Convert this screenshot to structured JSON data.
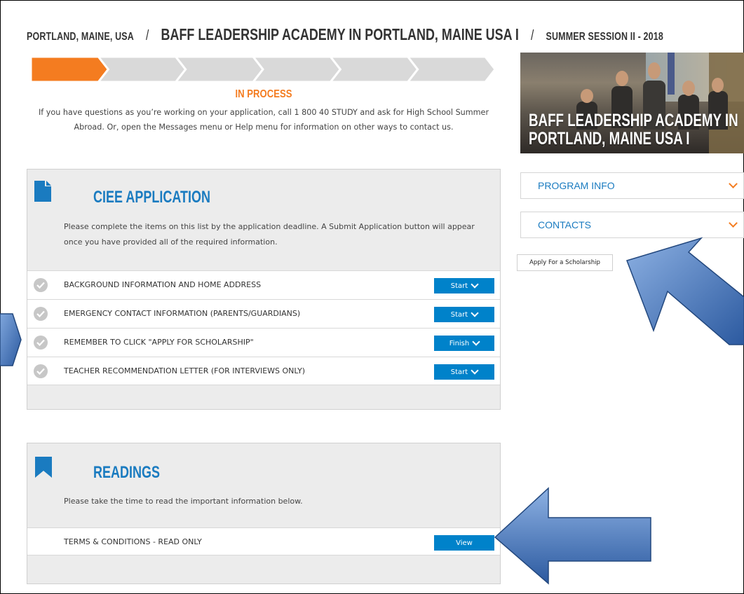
{
  "breadcrumb": {
    "location": "PORTLAND, MAINE, USA",
    "program": "BAFF LEADERSHIP ACADEMY IN PORTLAND, MAINE USA I",
    "session": "SUMMER SESSION II - 2018",
    "separator": "/"
  },
  "progress": {
    "steps_total": 6,
    "current_step": 1,
    "active_color": "#f47c20",
    "inactive_color": "#d9d9d9"
  },
  "status": "IN PROCESS",
  "intro": "If you have questions as you’re working on your application, call 1 800 40 STUDY and ask for High School Summer Abroad. Or, open the Messages menu or Help menu for information on other ways to contact us.",
  "application": {
    "title": "CIEE APPLICATION",
    "icon": "document-icon",
    "description": "Please complete the items on this list by the application deadline. A Submit Application button will appear once you have provided all of the required information.",
    "items": [
      {
        "label": "BACKGROUND INFORMATION AND HOME ADDRESS",
        "button": "Start"
      },
      {
        "label": "EMERGENCY CONTACT INFORMATION (PARENTS/GUARDIANS)",
        "button": "Start"
      },
      {
        "label": "REMEMBER TO CLICK \"APPLY FOR SCHOLARSHIP\"",
        "button": "Finish"
      },
      {
        "label": "TEACHER RECOMMENDATION LETTER (FOR INTERVIEWS ONLY)",
        "button": "Start"
      }
    ]
  },
  "readings": {
    "title": "READINGS",
    "icon": "bookmark-icon",
    "description": "Please take the time to read the important information below.",
    "items": [
      {
        "label": "TERMS & CONDITIONS - READ ONLY",
        "button": "View"
      }
    ]
  },
  "sidebar": {
    "hero_title": "BAFF LEADERSHIP ACADEMY IN PORTLAND, MAINE USA I",
    "program_info": "PROGRAM INFO",
    "contacts": "CONTACTS",
    "scholarship_button": "Apply For a Scholarship"
  },
  "colors": {
    "accent": "#f47c20",
    "primary": "#0082ca",
    "title_blue": "#1a7bc0",
    "panel_bg": "#ececec",
    "annotation_arrow": "#3f6fb6"
  }
}
